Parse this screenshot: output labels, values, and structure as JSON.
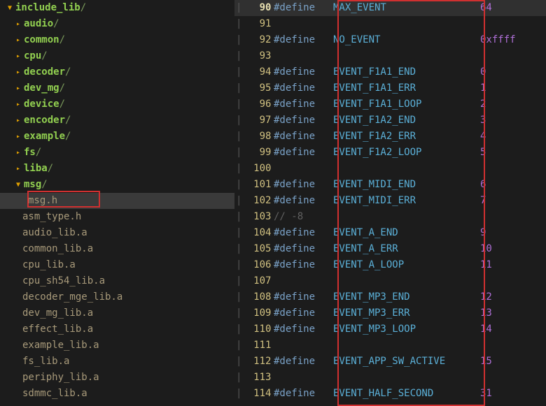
{
  "sidebar": {
    "root": "include_lib",
    "dirs": [
      "audio",
      "common",
      "cpu",
      "decoder",
      "dev_mg",
      "device",
      "encoder",
      "example",
      "fs",
      "liba",
      "msg"
    ],
    "open_dir_file": "msg.h",
    "files": [
      "asm_type.h",
      "audio_lib.a",
      "common_lib.a",
      "cpu_lib.a",
      "cpu_sh54_lib.a",
      "decoder_mge_lib.a",
      "dev_mg_lib.a",
      "effect_lib.a",
      "example_lib.a",
      "fs_lib.a",
      "periphy_lib.a",
      "sdmmc_lib.a"
    ]
  },
  "code": {
    "lines": [
      {
        "n": 90,
        "d": "#define",
        "name": "MAX_EVENT",
        "val": "64",
        "cursor": true
      },
      {
        "n": 91,
        "d": "",
        "name": "",
        "val": ""
      },
      {
        "n": 92,
        "d": "#define",
        "name": "NO_EVENT",
        "val": "0xffff"
      },
      {
        "n": 93,
        "d": "",
        "name": "",
        "val": ""
      },
      {
        "n": 94,
        "d": "#define",
        "name": "EVENT_F1A1_END",
        "val": "0"
      },
      {
        "n": 95,
        "d": "#define",
        "name": "EVENT_F1A1_ERR",
        "val": "1"
      },
      {
        "n": 96,
        "d": "#define",
        "name": "EVENT_F1A1_LOOP",
        "val": "2"
      },
      {
        "n": 97,
        "d": "#define",
        "name": "EVENT_F1A2_END",
        "val": "3"
      },
      {
        "n": 98,
        "d": "#define",
        "name": "EVENT_F1A2_ERR",
        "val": "4"
      },
      {
        "n": 99,
        "d": "#define",
        "name": "EVENT_F1A2_LOOP",
        "val": "5"
      },
      {
        "n": 100,
        "d": "",
        "name": "",
        "val": ""
      },
      {
        "n": 101,
        "d": "#define",
        "name": "EVENT_MIDI_END",
        "val": "6"
      },
      {
        "n": 102,
        "d": "#define",
        "name": "EVENT_MIDI_ERR",
        "val": "7"
      },
      {
        "n": 103,
        "d": "",
        "name": "",
        "val": "",
        "comment": "//                              -8"
      },
      {
        "n": 104,
        "d": "#define",
        "name": "EVENT_A_END",
        "val": "9"
      },
      {
        "n": 105,
        "d": "#define",
        "name": "EVENT_A_ERR",
        "val": "10"
      },
      {
        "n": 106,
        "d": "#define",
        "name": "EVENT_A_LOOP",
        "val": "11"
      },
      {
        "n": 107,
        "d": "",
        "name": "",
        "val": ""
      },
      {
        "n": 108,
        "d": "#define",
        "name": "EVENT_MP3_END",
        "val": "12"
      },
      {
        "n": 109,
        "d": "#define",
        "name": "EVENT_MP3_ERR",
        "val": "13"
      },
      {
        "n": 110,
        "d": "#define",
        "name": "EVENT_MP3_LOOP",
        "val": "14"
      },
      {
        "n": 111,
        "d": "",
        "name": "",
        "val": ""
      },
      {
        "n": 112,
        "d": "#define",
        "name": "EVENT_APP_SW_ACTIVE",
        "val": "15"
      },
      {
        "n": 113,
        "d": "",
        "name": "",
        "val": ""
      },
      {
        "n": 114,
        "d": "#define",
        "name": "EVENT_HALF_SECOND",
        "val": "31"
      }
    ]
  }
}
